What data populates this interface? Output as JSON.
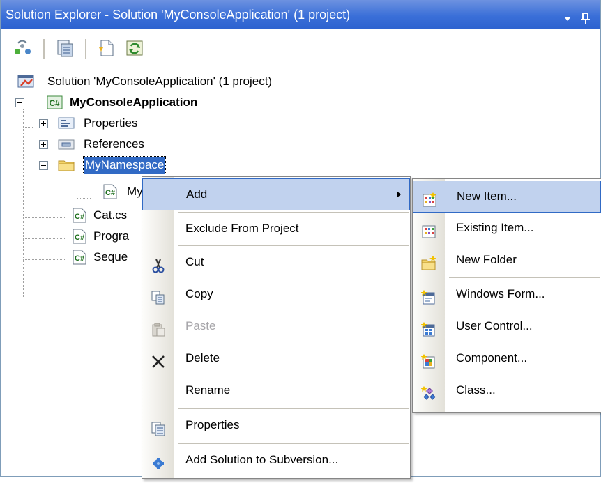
{
  "titlebar": {
    "title": "Solution Explorer - Solution 'MyConsoleApplication' (1 project)"
  },
  "tree": {
    "solution": "Solution 'MyConsoleApplication' (1 project)",
    "project": "MyConsoleApplication",
    "properties": "Properties",
    "references": "References",
    "namespace": "MyNamespace",
    "namespace_child": "My",
    "cat": "Cat.cs",
    "program": "Progra",
    "seque": "Seque"
  },
  "context_menu": {
    "items": [
      "Add",
      "Exclude From Project",
      "Cut",
      "Copy",
      "Paste",
      "Delete",
      "Rename",
      "Properties",
      "Add Solution to Subversion..."
    ]
  },
  "submenu": {
    "items": [
      "New Item...",
      "Existing Item...",
      "New Folder",
      "Windows Form...",
      "User Control...",
      "Component...",
      "Class..."
    ]
  },
  "colors": {
    "titlebar": "#3a6fd8",
    "highlight": "#c1d2ee",
    "highlight_border": "#316ac5"
  }
}
